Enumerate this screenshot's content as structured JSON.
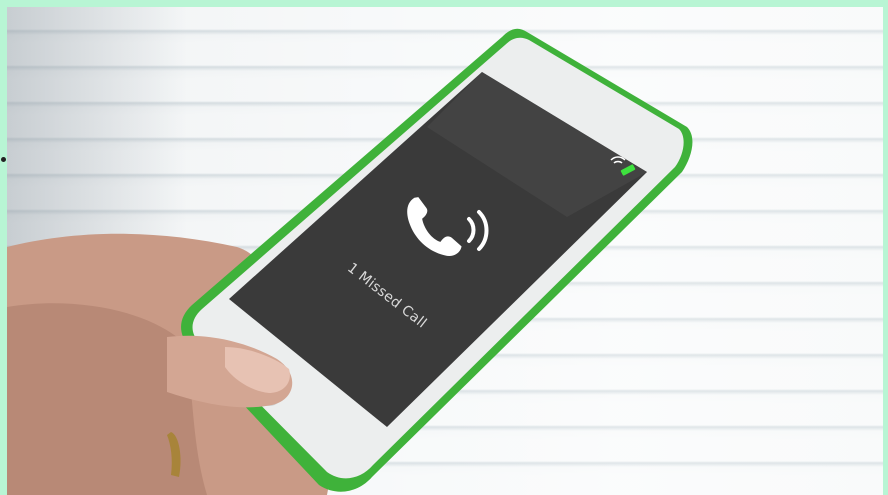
{
  "screen": {
    "notification": "1 Missed Call"
  },
  "icons": [
    "phone-icon",
    "sound-waves-icon",
    "wifi-icon",
    "battery-icon"
  ],
  "colors": {
    "frame_border": "#b8f5d4",
    "phone_case": "#3fb23a",
    "screen": "#3a3a3a",
    "battery": "#3ee23e"
  }
}
